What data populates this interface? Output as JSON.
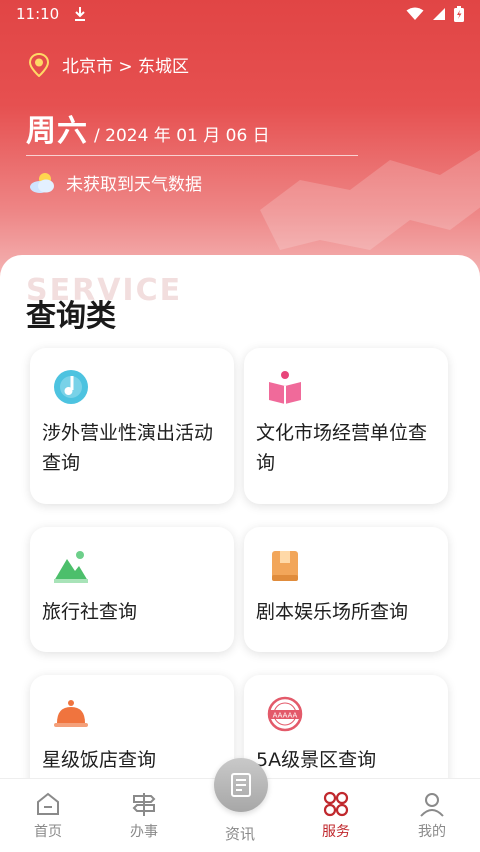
{
  "status_bar": {
    "time": "11:10"
  },
  "header": {
    "location": "北京市 > 东城区",
    "weekday": "周六",
    "date": "/ 2024 年 01 月 06 日",
    "weather": "未获取到天气数据"
  },
  "section": {
    "watermark": "SERVICE",
    "title": "查询类"
  },
  "cards": [
    {
      "label": "涉外营业性演出活动查询",
      "icon": "music-note-icon"
    },
    {
      "label": "文化市场经营单位查询",
      "icon": "open-book-icon"
    },
    {
      "label": "旅行社查询",
      "icon": "mountain-icon"
    },
    {
      "label": "剧本娱乐场所查询",
      "icon": "script-book-icon"
    },
    {
      "label": "星级饭店查询",
      "icon": "service-bell-icon"
    },
    {
      "label": "5A级景区查询",
      "icon": "aaaaa-badge-icon"
    }
  ],
  "tabbar": {
    "home": "首页",
    "affairs": "办事",
    "news": "资讯",
    "services": "服务",
    "mine": "我的",
    "active": "服务"
  },
  "colors": {
    "brand_red": "#e14545",
    "active_tab": "#c0282d"
  }
}
